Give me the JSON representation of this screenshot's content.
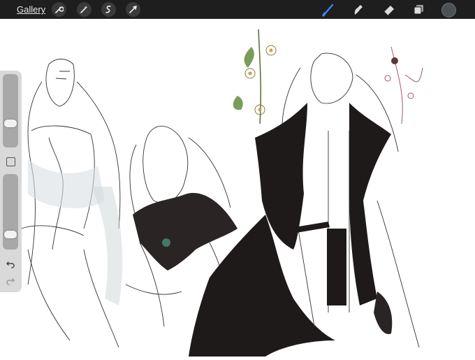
{
  "toolbar": {
    "gallery_label": "Gallery",
    "left_icons": [
      "wrench-icon",
      "magic-wand-icon",
      "selection-icon",
      "transform-arrow-icon"
    ],
    "right_icons": [
      "brush-icon",
      "smudge-icon",
      "eraser-icon",
      "layers-icon"
    ],
    "accent_color": "#3b82f6",
    "current_color": "#4a5256"
  },
  "sidebar": {
    "brush_size_level": 0.3,
    "opacity_level": 0.15
  }
}
